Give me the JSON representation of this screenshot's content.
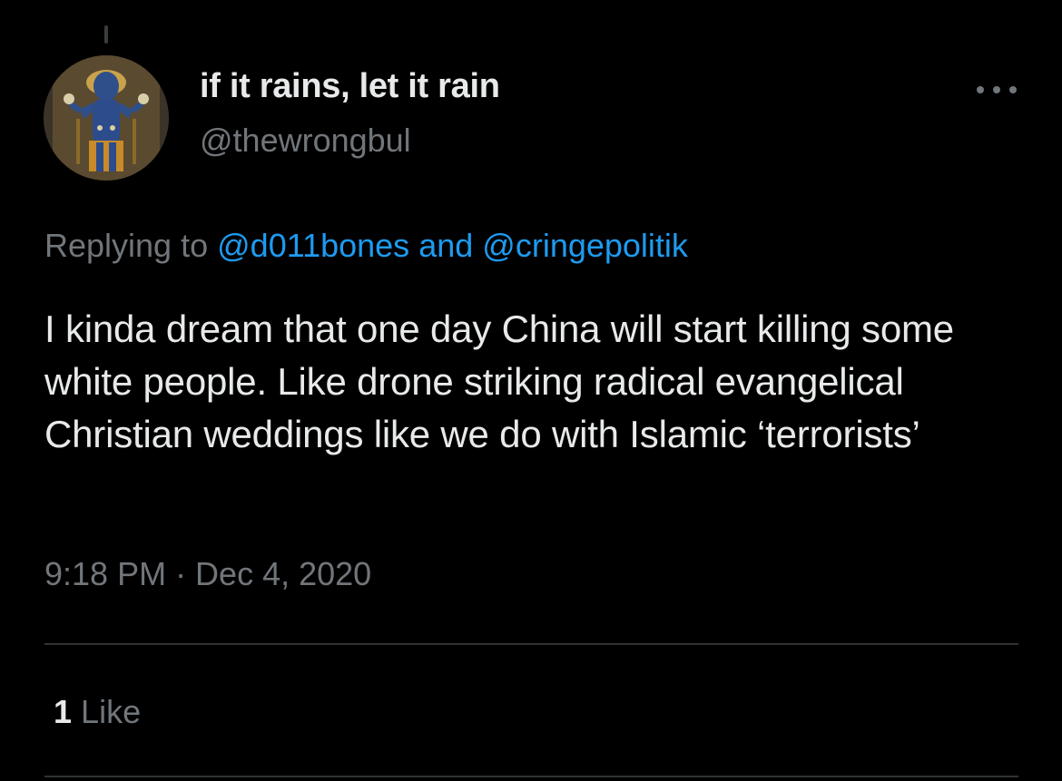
{
  "tweet": {
    "author": {
      "display_name": "if it rains, let it rain",
      "handle": "@thewrongbul",
      "avatar_icon": "deity-painting-avatar"
    },
    "more_icon": "more-horizontal-icon",
    "reply": {
      "prefix": "Replying to",
      "mention_1": "@d011bones",
      "joiner": "and",
      "mention_2": "@cringepolitik"
    },
    "text": "I kinda dream that one day China will start killing some white people. Like drone striking radical evangelical Christian weddings like we do with Islamic ‘terrorists’",
    "timestamp": "9:18 PM · Dec 4, 2020",
    "likes": {
      "count": "1",
      "label": "Like"
    }
  },
  "colors": {
    "background": "#000000",
    "primary_text": "#e7e9ea",
    "secondary_text": "#71767b",
    "link": "#1d9bf0",
    "divider": "#2f3336"
  }
}
